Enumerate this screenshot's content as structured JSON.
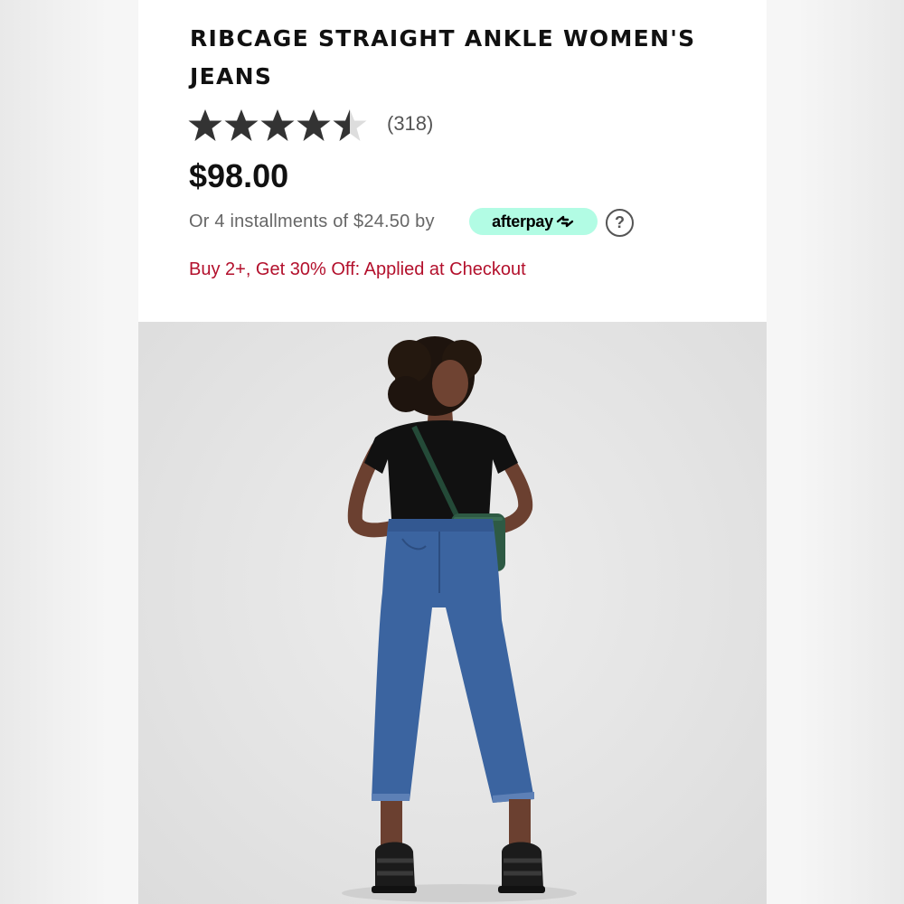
{
  "product": {
    "title": "RIBCAGE STRAIGHT ANKLE WOMEN'S JEANS",
    "rating": 4.5,
    "rating_max": 5,
    "review_count": "(318)",
    "price": "$98.00",
    "installments_text": "Or 4 installments of $24.50 by",
    "afterpay_label": "afterpay",
    "help_icon_glyph": "?",
    "promo_text": "Buy 2+, Get 30% Off: Applied at Checkout"
  },
  "colors": {
    "title": "#111111",
    "star_filled": "#333333",
    "star_empty": "#dddddd",
    "afterpay_bg": "#b2fce4",
    "promo": "#b3102c",
    "denim": "#3b64a0",
    "bag": "#2e5a44"
  },
  "icons": [
    "star-icon",
    "afterpay-arrows-icon",
    "question-circle-icon"
  ]
}
